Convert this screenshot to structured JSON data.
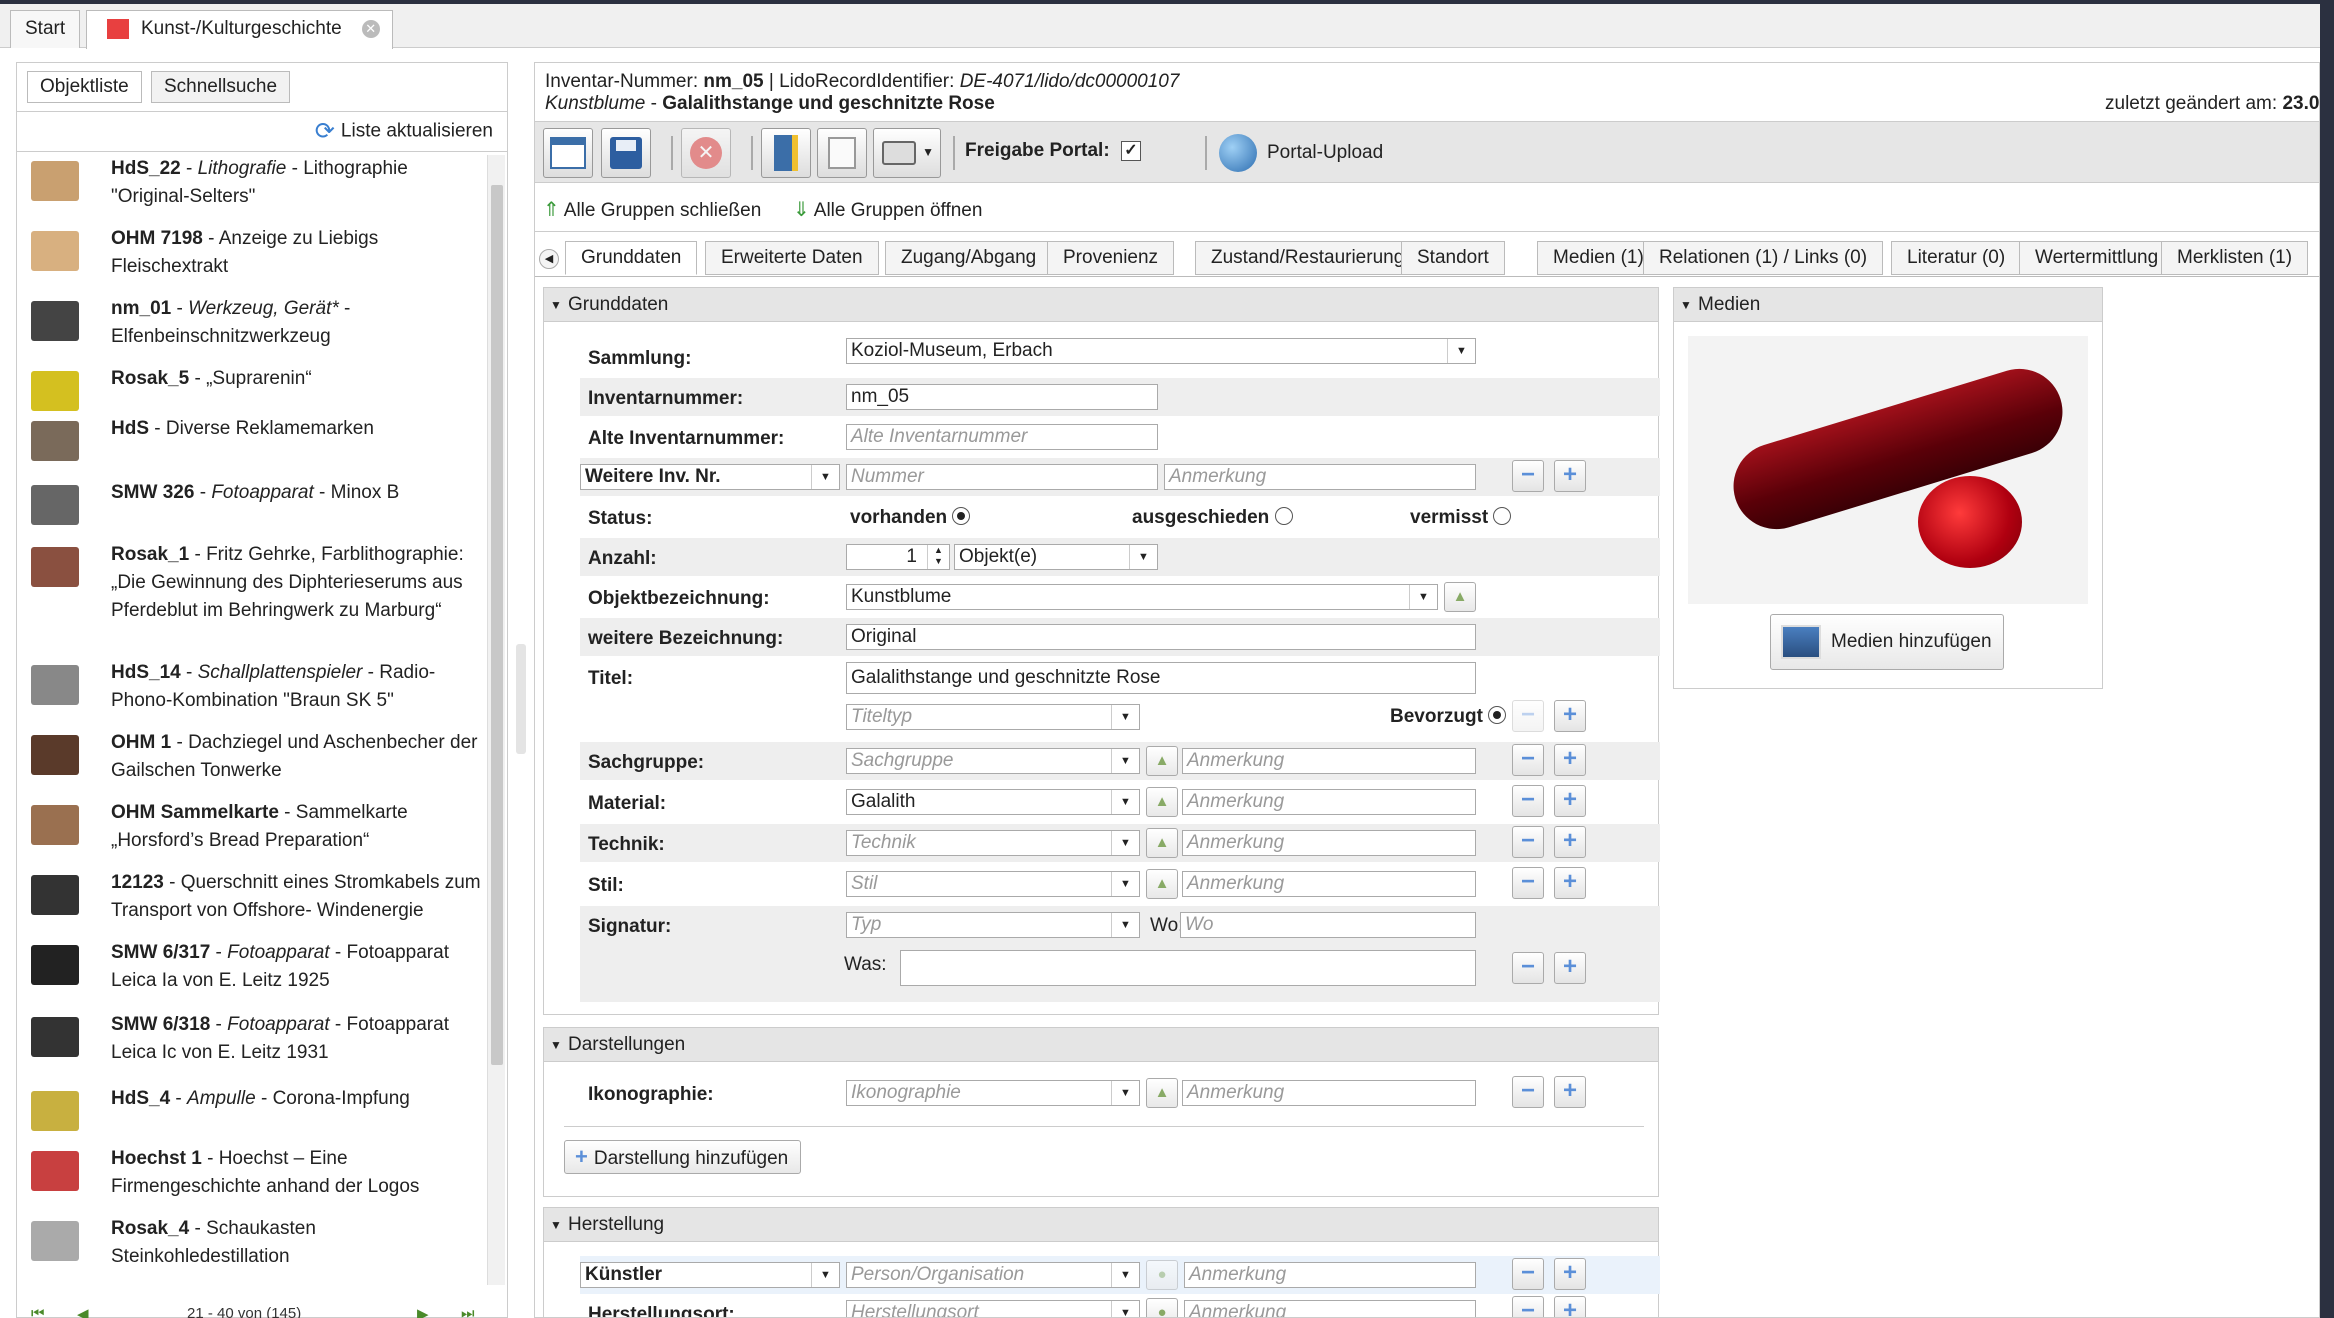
{
  "top_tabs": [
    {
      "label": "Start"
    },
    {
      "label": "Kunst-/Kulturgeschichte"
    }
  ],
  "left": {
    "tabs": [
      "Objektliste",
      "Schnellsuche"
    ],
    "refresh_label": "Liste aktualisieren",
    "items": [
      {
        "id": "HdS_22",
        "type": "Lithografie",
        "desc": "Lithographie \"Original-Selters\""
      },
      {
        "id": "OHM 7198",
        "type": "",
        "desc": "Anzeige zu Liebigs Fleischextrakt"
      },
      {
        "id": "nm_01",
        "type": "Werkzeug, Gerät*",
        "desc": "Elfenbeinschnitzwerkzeug"
      },
      {
        "id": "Rosak_5",
        "type": "",
        "desc": "„Suprarenin“"
      },
      {
        "id": "HdS",
        "type": "",
        "desc": "Diverse Reklamemarken"
      },
      {
        "id": "SMW 326",
        "type": "Fotoapparat",
        "desc": "Minox B"
      },
      {
        "id": "Rosak_1",
        "type": "",
        "desc": "Fritz Gehrke, Farblithographie: „Die Gewinnung des Diphterieserums aus Pferdeblut im Behringwerk zu Marburg“"
      },
      {
        "id": "HdS_14",
        "type": "Schallplattenspieler",
        "desc": "Radio-Phono-Kombination \"Braun SK 5\""
      },
      {
        "id": "OHM 1",
        "type": "",
        "desc": "Dachziegel und Aschenbecher der Gailschen Tonwerke"
      },
      {
        "id": "OHM Sammelkarte",
        "type": "",
        "desc": "Sammelkarte „Horsford’s Bread Preparation“"
      },
      {
        "id": "12123",
        "type": "",
        "desc": "Querschnitt eines Stromkabels zum Transport von Offshore- Windenergie"
      },
      {
        "id": "SMW 6/317",
        "type": "Fotoapparat",
        "desc": "Fotoapparat Leica Ia von E. Leitz 1925"
      },
      {
        "id": "SMW 6/318",
        "type": "Fotoapparat",
        "desc": "Fotoapparat Leica Ic von E. Leitz 1931"
      },
      {
        "id": "HdS_4",
        "type": "Ampulle",
        "desc": "Corona-Impfung"
      },
      {
        "id": "Hoechst 1",
        "type": "",
        "desc": "Hoechst – Eine Firmengeschichte anhand der Logos"
      },
      {
        "id": "Rosak_4",
        "type": "",
        "desc": "Schaukasten Steinkohledestillation"
      }
    ],
    "pager": "21 - 40 von (145)"
  },
  "header": {
    "inv_label": "Inventar-Nummer:",
    "inv_value": "nm_05",
    "lido_label": "| LidoRecordIdentifier:",
    "lido_value": "DE-4071/lido/dc00000107",
    "obj_type": "Kunstblume",
    "obj_title": "Galalithstange und geschnitzte Rose",
    "changed_label": "zuletzt geändert am:",
    "changed_value": "23.0"
  },
  "toolbar": {
    "freigabe_label": "Freigabe Portal:",
    "upload_label": "Portal-Upload"
  },
  "groups": {
    "close_all": "Alle Gruppen schließen",
    "open_all": "Alle Gruppen öffnen"
  },
  "content_tabs": [
    "Grunddaten",
    "Erweiterte Daten",
    "Zugang/Abgang",
    "Provenienz",
    "Zustand/Restaurierung",
    "Standort",
    "Medien (1)",
    "Relationen (1) / Links (0)",
    "Literatur (0)",
    "Wertermittlung",
    "Merklisten (1)"
  ],
  "grunddaten": {
    "title": "Grunddaten",
    "sammlung_label": "Sammlung:",
    "sammlung_value": "Koziol-Museum, Erbach",
    "inv_label": "Inventarnummer:",
    "inv_value": "nm_05",
    "alt_inv_label": "Alte Inventarnummer:",
    "alt_inv_ph": "Alte Inventarnummer",
    "weitere_inv_label": "Weitere Inv. Nr.",
    "nummer_ph": "Nummer",
    "anmerkung_ph": "Anmerkung",
    "status_label": "Status:",
    "status_opts": [
      "vorhanden",
      "ausgeschieden",
      "vermisst"
    ],
    "anzahl_label": "Anzahl:",
    "anzahl_value": "1",
    "anzahl_unit": "Objekt(e)",
    "objbez_label": "Objektbezeichnung:",
    "objbez_value": "Kunstblume",
    "weitere_bez_label": "weitere Bezeichnung:",
    "weitere_bez_value": "Original",
    "titel_label": "Titel:",
    "titel_value": "Galalithstange und geschnitzte Rose",
    "titeltyp_ph": "Titeltyp",
    "bevorzugt_label": "Bevorzugt",
    "sachgruppe_label": "Sachgruppe:",
    "sachgruppe_ph": "Sachgruppe",
    "material_label": "Material:",
    "material_value": "Galalith",
    "technik_label": "Technik:",
    "technik_ph": "Technik",
    "stil_label": "Stil:",
    "stil_ph": "Stil",
    "signatur_label": "Signatur:",
    "typ_ph": "Typ",
    "wo_label": "Wo:",
    "wo_ph": "Wo",
    "was_label": "Was:"
  },
  "medien": {
    "title": "Medien",
    "add_label": "Medien hinzufügen"
  },
  "darstellungen": {
    "title": "Darstellungen",
    "ikon_label": "Ikonographie:",
    "ikon_ph": "Ikonographie",
    "anmerkung_ph": "Anmerkung",
    "add_label": "Darstellung hinzufügen"
  },
  "herstellung": {
    "title": "Herstellung",
    "kuenstler_label": "Künstler",
    "person_ph": "Person/Organisation",
    "anmerkung_ph": "Anmerkung",
    "ort_label": "Herstellungsort:",
    "ort_ph": "Herstellungsort"
  }
}
